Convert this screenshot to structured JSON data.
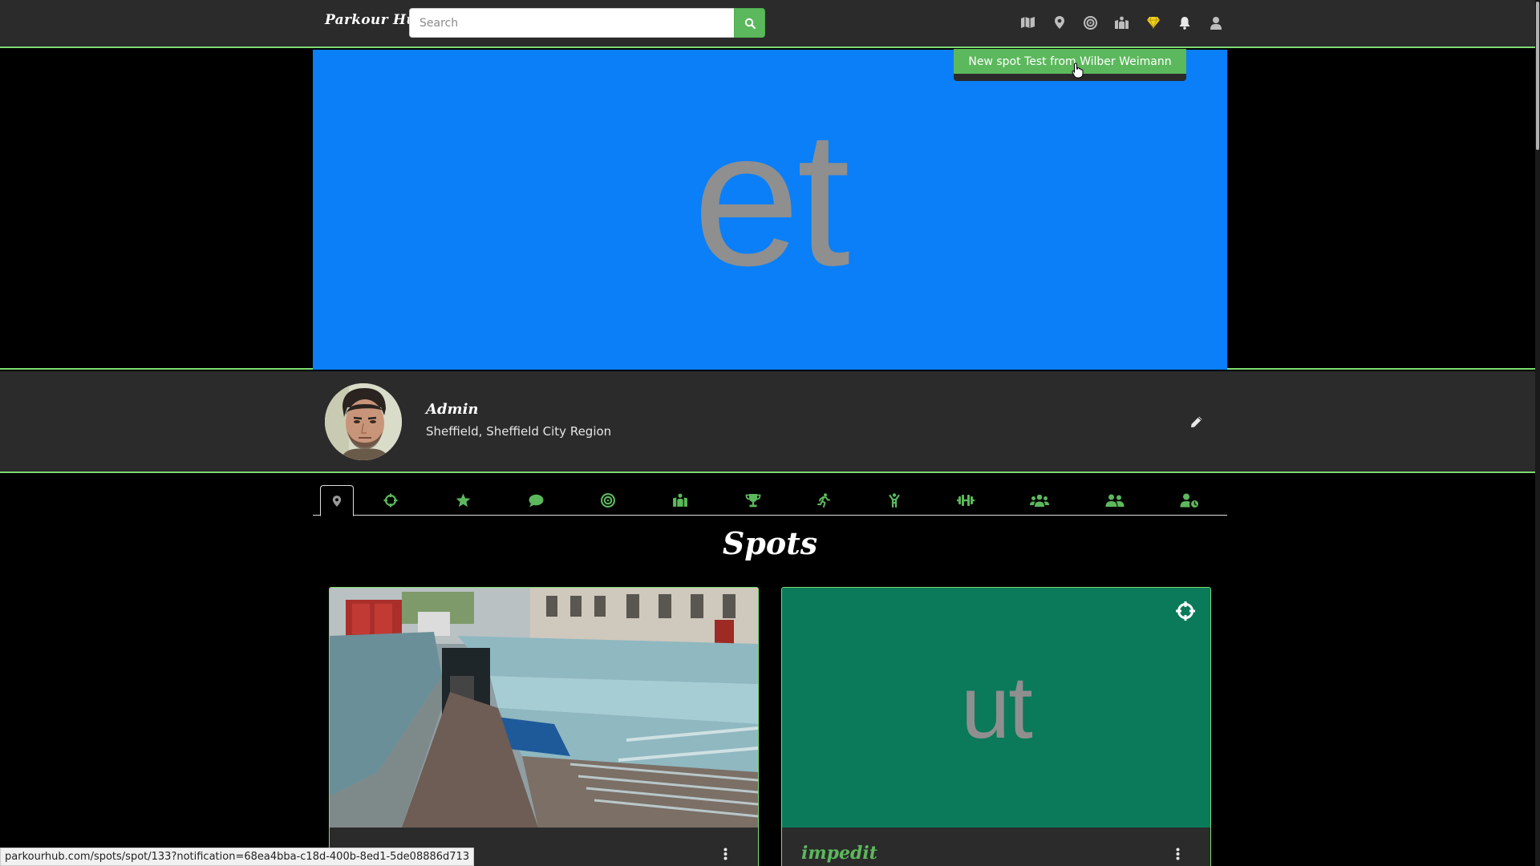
{
  "header": {
    "brand": "Parkour Hub",
    "search": {
      "placeholder": "Search",
      "value": ""
    },
    "nav_icons": [
      "map-icon",
      "map-marker-icon",
      "target-icon",
      "map-person-icon",
      "gem-icon",
      "bell-icon",
      "user-icon"
    ]
  },
  "notification": {
    "text": "New spot Test from Wilber Weimann"
  },
  "banner": {
    "text": "et",
    "bg_color": "#0a7ff7"
  },
  "profile": {
    "name": "Admin",
    "location": "Sheffield, Sheffield City Region"
  },
  "tabs": [
    "spots-tab",
    "hitlist-tab",
    "reviews-tab",
    "comments-tab",
    "challenges-tab",
    "workouts-tab",
    "achievements-tab",
    "moves-tab",
    "equipment-tab",
    "exercises-tab",
    "followers-tab",
    "following-tab",
    "follow-requests-tab"
  ],
  "section": {
    "title": "Spots"
  },
  "cards": [
    {
      "title": "",
      "image": "underpass-photo"
    },
    {
      "title": "impedit",
      "image_text": "ut",
      "bg_color": "#0a7a5a"
    }
  ],
  "statusbar": {
    "url": "parkourhub.com/spots/spot/133?notification=68ea4bba-c18d-400b-8ed1-5de08886d713"
  },
  "colors": {
    "accent": "#7ddb70",
    "button": "#5cb85c",
    "panel": "#2b2b2b",
    "gem": "#f2d21b"
  }
}
